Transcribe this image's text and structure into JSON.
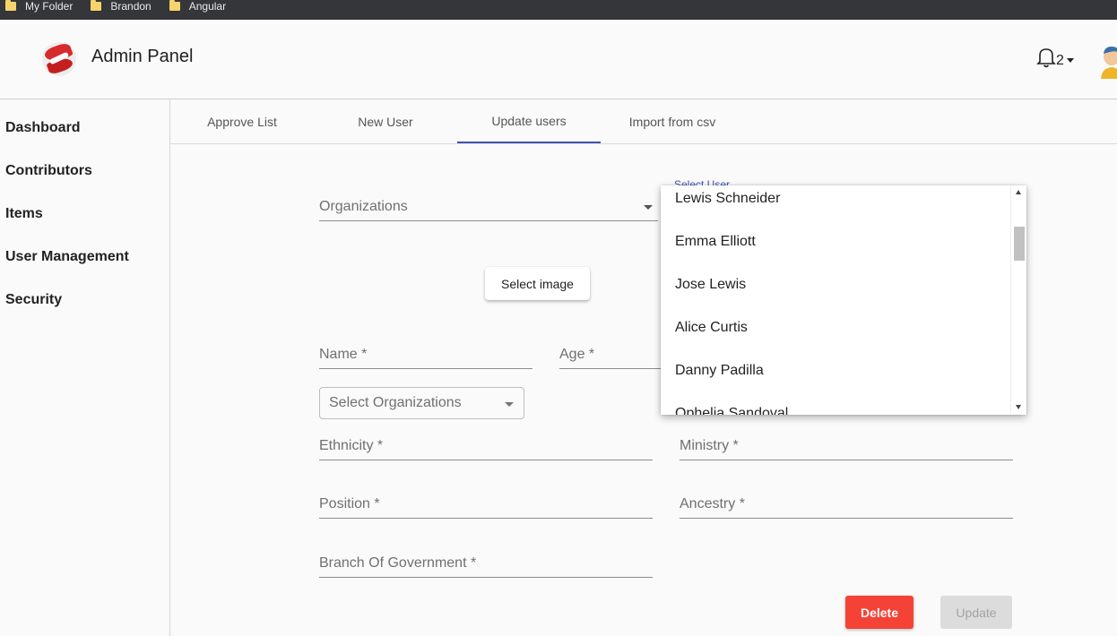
{
  "bookmarks": [
    "My Folder",
    "Brandon",
    "Angular"
  ],
  "header": {
    "title": "Admin Panel",
    "notification_count": "2"
  },
  "sidebar": {
    "items": [
      {
        "label": "Dashboard"
      },
      {
        "label": "Contributors"
      },
      {
        "label": "Items"
      },
      {
        "label": "User Management"
      },
      {
        "label": "Security"
      }
    ]
  },
  "tabs": [
    {
      "label": "Approve List"
    },
    {
      "label": "New User"
    },
    {
      "label": "Update users",
      "active": true
    },
    {
      "label": "Import from csv"
    }
  ],
  "form": {
    "organizations": "Organizations",
    "select_user_label": "Select User",
    "select_image": "Select image",
    "name": "Name *",
    "age": "Age *",
    "select_organizations": "Select Organizations",
    "ethnicity": "Ethnicity *",
    "ministry": "Ministry *",
    "position": "Position *",
    "ancestry": "Ancestry *",
    "branch": "Branch Of Government *",
    "delete": "Delete",
    "update": "Update"
  },
  "user_options": [
    "Lewis Schneider",
    "Emma Elliott",
    "Jose Lewis",
    "Alice Curtis",
    "Danny Padilla",
    "Ophelia Sandoval"
  ],
  "colors": {
    "accent": "#3f51b5",
    "delete": "#f44336",
    "bookmark_bar": "#35363a"
  }
}
